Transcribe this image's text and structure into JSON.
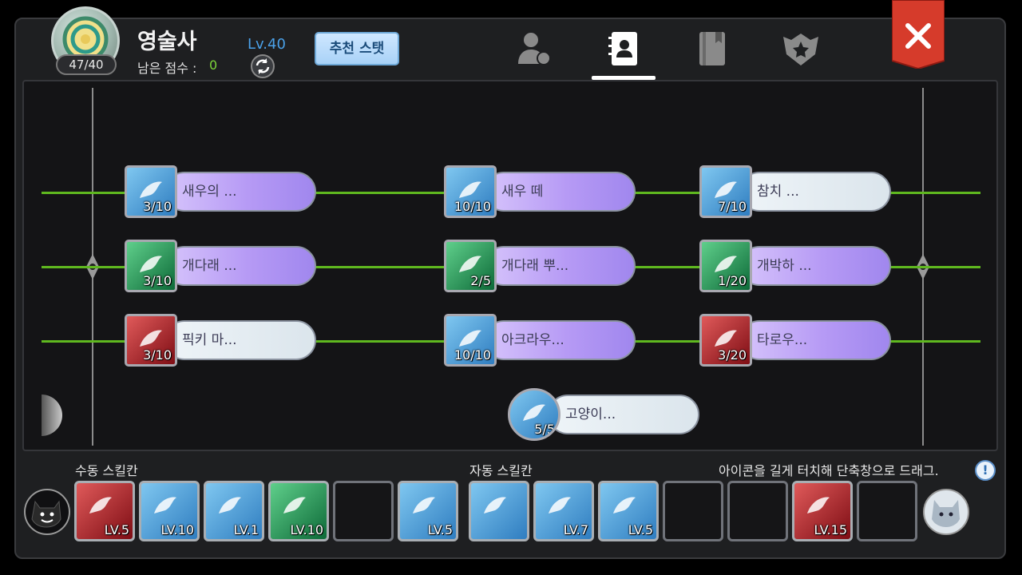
{
  "header": {
    "skill_points_badge": "47/40",
    "job_name": "영술사",
    "remaining_points_label": "남은 점수 :",
    "remaining_points_value": "0",
    "level": "Lv.40",
    "recommend_button": "추천 스탯"
  },
  "tabs": [
    {
      "icon": "character-icon",
      "active": false
    },
    {
      "icon": "skill-book-icon",
      "active": true
    },
    {
      "icon": "book-icon",
      "active": false
    },
    {
      "icon": "emblem-star-icon",
      "active": false
    }
  ],
  "skills": {
    "row1": [
      {
        "name": "새우의 ...",
        "level": "3/10",
        "color": "blue",
        "pill": "purple"
      },
      {
        "name": "새우 떼",
        "level": "10/10",
        "color": "blue",
        "pill": "purple"
      },
      {
        "name": "참치 ...",
        "level": "7/10",
        "color": "blue",
        "pill": "white"
      }
    ],
    "row2": [
      {
        "name": "개다래 ...",
        "level": "3/10",
        "color": "green",
        "pill": "purple"
      },
      {
        "name": "개다래 뿌...",
        "level": "2/5",
        "color": "green",
        "pill": "purple"
      },
      {
        "name": "개박하 ...",
        "level": "1/20",
        "color": "green",
        "pill": "purple"
      }
    ],
    "row3": [
      {
        "name": "픽키 마...",
        "level": "3/10",
        "color": "red",
        "pill": "white"
      },
      {
        "name": "아크라우...",
        "level": "10/10",
        "color": "blue",
        "pill": "purple"
      },
      {
        "name": "타로우...",
        "level": "3/20",
        "color": "red",
        "pill": "purple"
      }
    ],
    "row4": [
      {
        "name": "고양이...",
        "level": "5/5",
        "color": "blue",
        "pill": "white"
      }
    ]
  },
  "bottom": {
    "manual_label": "수동 스킬칸",
    "auto_label": "자동 스킬칸",
    "hint": "아이콘을 길게 터치해 단축창으로 드래그.",
    "info_glyph": "!",
    "manual_slots": [
      {
        "level": "LV.5",
        "color": "red"
      },
      {
        "level": "LV.10",
        "color": "blue"
      },
      {
        "level": "LV.1",
        "color": "blue"
      },
      {
        "level": "LV.10",
        "color": "green"
      },
      {
        "level": "",
        "color": "empty"
      },
      {
        "level": "LV.5",
        "color": "blue"
      }
    ],
    "auto_slots": [
      {
        "level": "",
        "color": "blue"
      },
      {
        "level": "LV.7",
        "color": "blue"
      },
      {
        "level": "LV.5",
        "color": "blue"
      },
      {
        "level": "",
        "color": "empty"
      },
      {
        "level": "",
        "color": "empty"
      },
      {
        "level": "LV.15",
        "color": "red"
      },
      {
        "level": "",
        "color": "empty"
      }
    ]
  },
  "colors": {
    "accent_blue": "#4aa0e8",
    "points_green": "#7cd43a",
    "close_red": "#d63b2b",
    "link_line": "#5fb81f"
  }
}
